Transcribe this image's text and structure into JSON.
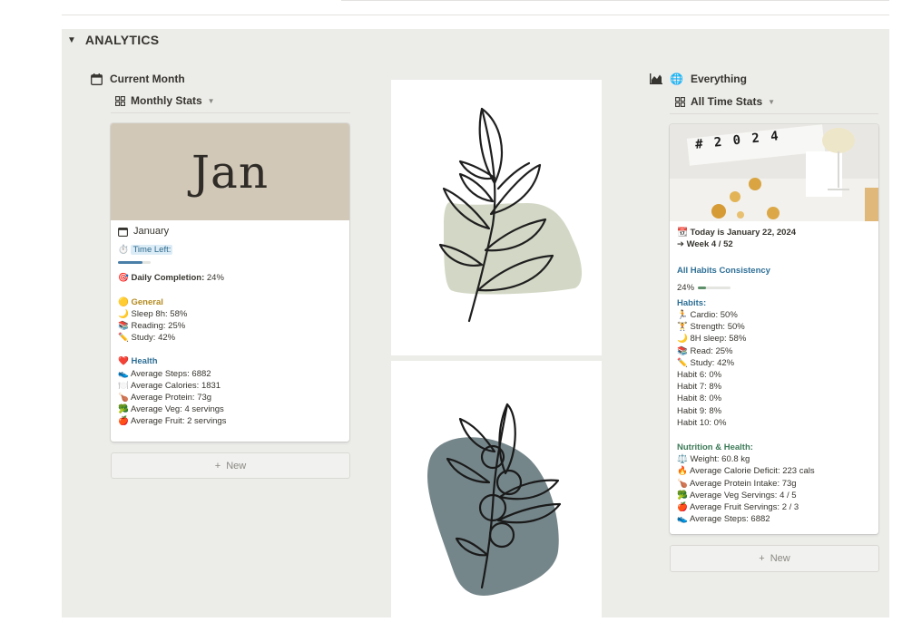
{
  "analytics": {
    "title": "ANALYTICS",
    "toggle": "▼"
  },
  "current_month": {
    "heading": "Current Month",
    "view": "Monthly Stats",
    "card": {
      "cover_text": "Jan",
      "title": "January",
      "time_left_label": "Time Left:",
      "time_left_progress": 0.75,
      "daily_label": "Daily Completion:",
      "daily_value": "24%",
      "general_label": "General",
      "general": [
        {
          "label": "Sleep 8h:",
          "value": "58%"
        },
        {
          "label": "Reading:",
          "value": "25%"
        },
        {
          "label": "Study:",
          "value": "42%"
        }
      ],
      "health_label": "Health",
      "health": [
        {
          "label": "Average Steps:",
          "value": "6882"
        },
        {
          "label": "Average Calories:",
          "value": "1831"
        },
        {
          "label": "Average Protein:",
          "value": "73g"
        },
        {
          "label": "Average Veg:",
          "value": "4 servings"
        },
        {
          "label": "Average Fruit:",
          "value": "2 servings"
        }
      ]
    },
    "new_label": "New"
  },
  "everything": {
    "heading": "Everything",
    "view": "All Time Stats",
    "card": {
      "cover_text": "# 2 0 2 4",
      "today": "Today is January 22, 2024",
      "week": "➔ Week 4 / 52",
      "consistency_label": "All Habits Consistency",
      "consistency_value": "24%",
      "consistency_progress": 0.24,
      "habits_label": "Habits:",
      "habits": [
        {
          "label": "Cardio:",
          "value": "50%"
        },
        {
          "label": "Strength:",
          "value": "50%"
        },
        {
          "label": "8H sleep:",
          "value": "58%"
        },
        {
          "label": "Read:",
          "value": "25%"
        },
        {
          "label": "Study:",
          "value": "42%"
        },
        {
          "label": "Habit 6:",
          "value": "0%"
        },
        {
          "label": "Habit 7:",
          "value": "8%"
        },
        {
          "label": "Habit 8:",
          "value": "0%"
        },
        {
          "label": "Habit 9:",
          "value": "8%"
        },
        {
          "label": "Habit 10:",
          "value": "0%"
        }
      ],
      "nutrition_label": "Nutrition & Health:",
      "nutrition": [
        {
          "label": "Weight:",
          "value": "60.8 kg"
        },
        {
          "label": "Average Calorie Deficit:",
          "value": "223 cals"
        },
        {
          "label": "Average Protein Intake:",
          "value": "73g"
        },
        {
          "label": "Average Veg Servings:",
          "value": "4 / 5"
        },
        {
          "label": "Average Fruit Servings:",
          "value": "2 / 3"
        },
        {
          "label": "Average Steps:",
          "value": "6882"
        }
      ]
    },
    "new_label": "New"
  },
  "colors": {
    "panel_bg": "#ecece9",
    "jan_cover": "#d1c8b8",
    "sage": "#d3d8c6",
    "slate": "#75868a",
    "progress_blue": "#4a7fa8",
    "progress_green": "#5d8f6b"
  }
}
